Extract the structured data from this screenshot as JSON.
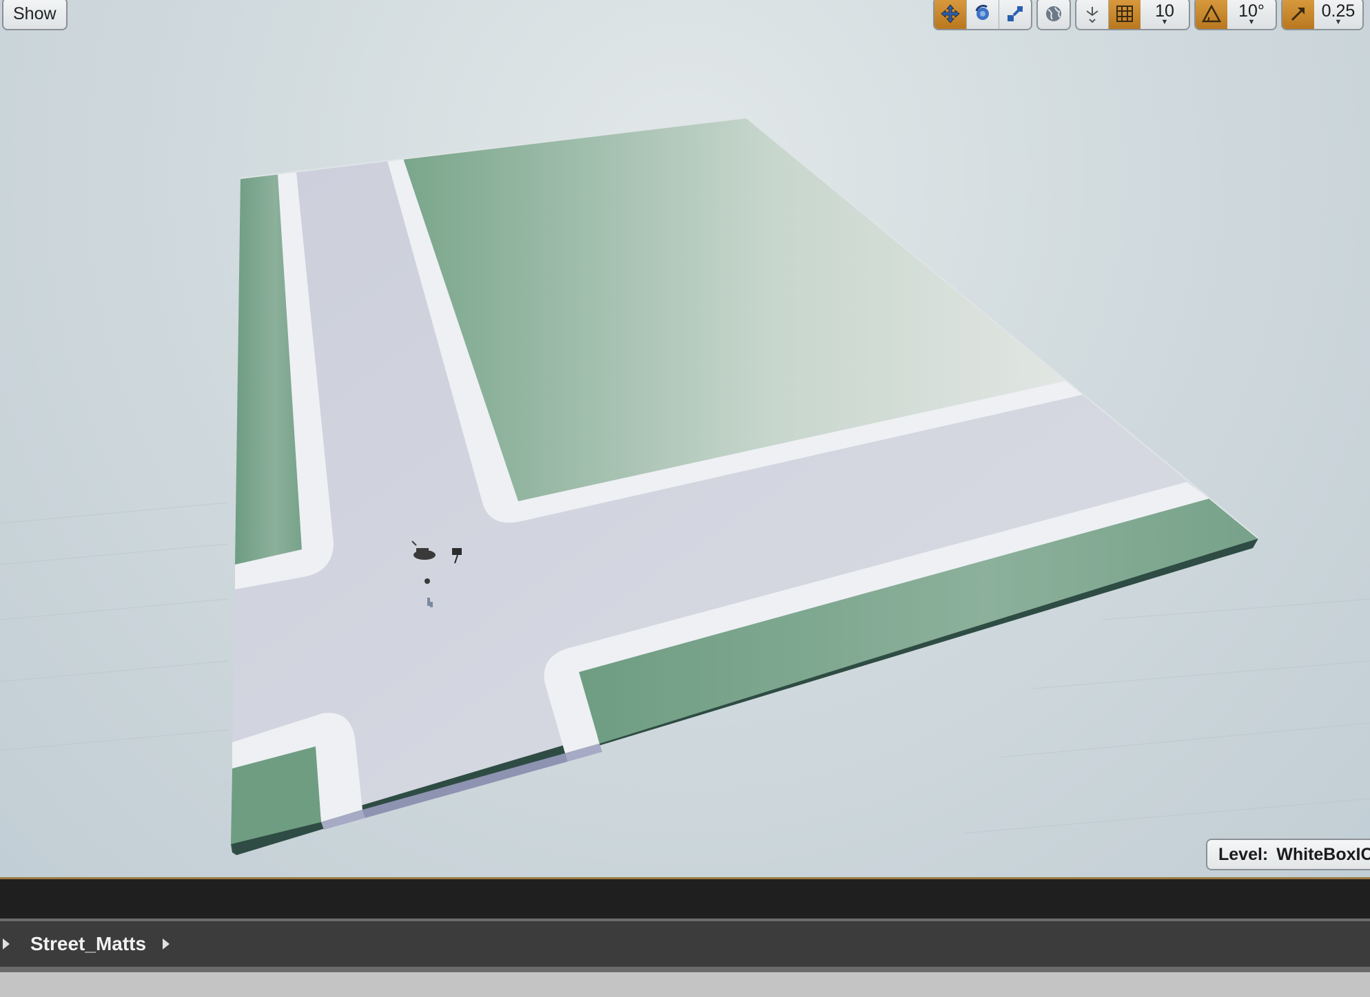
{
  "viewport": {
    "show_label": "Show",
    "level_prefix": "Level:",
    "level_name": "WhiteBoxICA"
  },
  "toolbar": {
    "grid_snap_value": "10",
    "rotation_snap_value": "10°",
    "scale_snap_value": "0.25",
    "accent_color": "#c6852a"
  },
  "breadcrumb": {
    "folder": "Street_Matts"
  },
  "scene_colors": {
    "grass": "#7aa68a",
    "road": "#d2d4de",
    "curb": "#eceef3",
    "slab_edge": "#2f4f45",
    "sky": "#d3dcdf"
  }
}
